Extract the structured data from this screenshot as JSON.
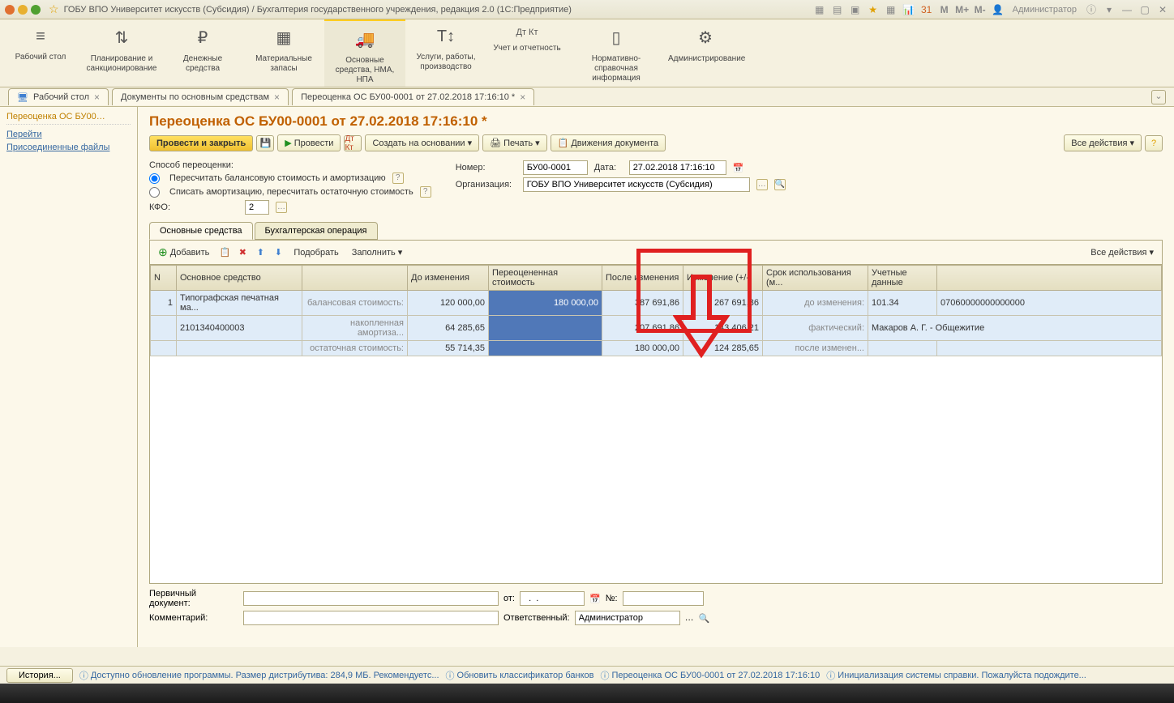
{
  "titlebar": {
    "title": "ГОБУ ВПО Университет искусств (Субсидия) / Бухгалтерия государственного учреждения, редакция 2.0  (1С:Предприятие)",
    "user": "Администратор",
    "m": "M",
    "mplus": "M+",
    "mminus": "M-"
  },
  "topnav": [
    {
      "icon": "≡",
      "label": "Рабочий стол"
    },
    {
      "icon": "⇅",
      "label": "Планирование и санкционирование"
    },
    {
      "icon": "₽",
      "label": "Денежные средства"
    },
    {
      "icon": "▦",
      "label": "Материальные запасы"
    },
    {
      "icon": "🚚",
      "label": "Основные средства, НМА, НПА"
    },
    {
      "icon": "T↕",
      "label": "Услуги, работы, производство"
    },
    {
      "icon": "Дт Кт",
      "label": "Учет и отчетность"
    },
    {
      "icon": "▯",
      "label": "Нормативно-справочная информация"
    },
    {
      "icon": "⚙",
      "label": "Администрирование"
    }
  ],
  "tabs": [
    {
      "label": "Рабочий стол"
    },
    {
      "label": "Документы по основным средствам"
    },
    {
      "label": "Переоценка ОС БУ00-0001 от 27.02.2018 17:16:10 *"
    }
  ],
  "sidebar": {
    "title": "Переоценка ОС БУ00…",
    "links": [
      "Перейти",
      "Присоединенные файлы"
    ]
  },
  "doc": {
    "title": "Переоценка ОС БУ00-0001 от 27.02.2018 17:16:10 *",
    "toolbar": {
      "post_close": "Провести и закрыть",
      "post": "Провести",
      "based_on": "Создать на основании",
      "print": "Печать",
      "movements": "Движения документа",
      "all_actions": "Все действия"
    },
    "form": {
      "method_label": "Способ переоценки:",
      "radio1": "Пересчитать балансовую стоимость и амортизацию",
      "radio2": "Списать амортизацию, пересчитать остаточную стоимость",
      "number_label": "Номер:",
      "number": "БУ00-0001",
      "date_label": "Дата:",
      "date": "27.02.2018 17:16:10",
      "org_label": "Организация:",
      "org": "ГОБУ ВПО Университет искусств (Субсидия)",
      "kfo_label": "КФО:",
      "kfo": "2"
    },
    "formtabs": [
      "Основные средства",
      "Бухгалтерская операция"
    ],
    "ttoolbar": {
      "add": "Добавить",
      "select": "Подобрать",
      "fill": "Заполнить",
      "all_actions": "Все действия"
    },
    "table": {
      "headers": [
        "N",
        "Основное средство",
        "",
        "До изменения",
        "Переоцененная стоимость",
        "После изменения",
        "Изменение (+/-)",
        "Срок использования (м...",
        "Учетные данные",
        ""
      ],
      "rows": [
        {
          "n": "1",
          "os": "Типографская печатная ма...",
          "lbl": "балансовая стоимость:",
          "before": "120 000,00",
          "reval": "180 000,00",
          "after": "387 691,86",
          "change": "267 691,86",
          "term": "до изменения:",
          "acc1": "101.34",
          "acc2": "07060000000000000"
        },
        {
          "n": "",
          "os": "2101340400003",
          "lbl": "накопленная амортиза...",
          "before": "64 285,65",
          "reval": "",
          "after": "207 691,86",
          "change": "143 406,21",
          "term": "фактический:",
          "acc1": "Макаров А. Г. - Общежитие",
          "acc2": ""
        },
        {
          "n": "",
          "os": "",
          "lbl": "остаточная стоимость:",
          "before": "55 714,35",
          "reval": "",
          "after": "180 000,00",
          "change": "124 285,65",
          "term": "после изменен...",
          "acc1": "",
          "acc2": ""
        }
      ]
    },
    "bottom": {
      "pdoc_label": "Первичный документ:",
      "from_label": "от:",
      "from": "  .  .    ",
      "no_label": "№:",
      "comment_label": "Комментарий:",
      "resp_label": "Ответственный:",
      "resp": "Администратор"
    }
  },
  "statusbar": {
    "history": "История...",
    "items": [
      "Доступно обновление программы. Размер дистрибутива: 284,9 МБ. Рекомендуетс...",
      "Обновить классификатор банков",
      "Переоценка ОС БУ00-0001 от 27.02.2018 17:16:10",
      "Инициализация системы справки. Пожалуйста подождите..."
    ]
  }
}
